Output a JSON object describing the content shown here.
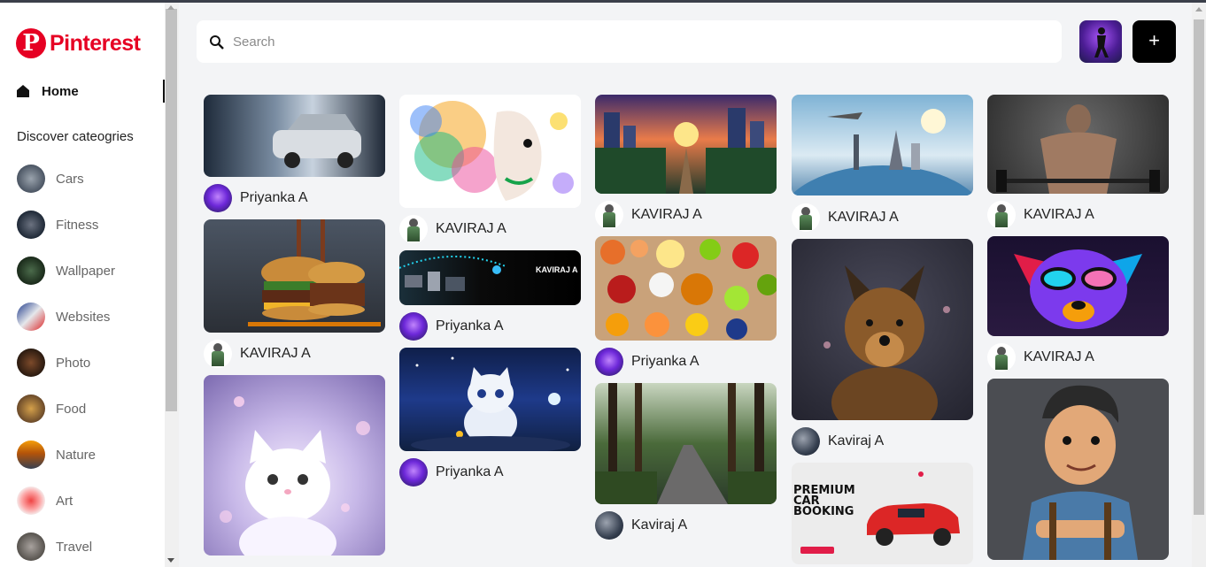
{
  "app": {
    "logo_text": "Pinterest"
  },
  "sidebar": {
    "home_label": "Home",
    "discover_heading": "Discover cateogries",
    "categories": [
      {
        "label": "Cars"
      },
      {
        "label": "Fitness"
      },
      {
        "label": "Wallpaper"
      },
      {
        "label": "Websites"
      },
      {
        "label": "Photo"
      },
      {
        "label": "Food"
      },
      {
        "label": "Nature"
      },
      {
        "label": "Art"
      },
      {
        "label": "Travel"
      }
    ]
  },
  "header": {
    "search_placeholder": "Search",
    "add_label": "+"
  },
  "pins": [
    {
      "subject": "car-tunnel",
      "author": "Priyanka A"
    },
    {
      "subject": "burger",
      "author": "KAVIRAJ A"
    },
    {
      "subject": "kitten-pink",
      "author": ""
    },
    {
      "subject": "colorful-art-face",
      "author": "KAVIRAJ A"
    },
    {
      "subject": "tech-banner",
      "author": "Priyanka A",
      "banner_text": "KAVIRAJ A"
    },
    {
      "subject": "kitten-night",
      "author": "Priyanka A"
    },
    {
      "subject": "city-sunset",
      "author": "KAVIRAJ A"
    },
    {
      "subject": "food-spread",
      "author": "Priyanka A"
    },
    {
      "subject": "forest-road",
      "author": "Kaviraj A"
    },
    {
      "subject": "globe-travel",
      "author": "KAVIRAJ A"
    },
    {
      "subject": "german-shepherd",
      "author": "Kaviraj A"
    },
    {
      "subject": "car-booking-ad",
      "author": "",
      "ad_text": "PREMIUM CAR BOOKING"
    },
    {
      "subject": "fitness-man",
      "author": "KAVIRAJ A"
    },
    {
      "subject": "neon-dog",
      "author": "KAVIRAJ A"
    },
    {
      "subject": "cartoon-man",
      "author": ""
    }
  ]
}
